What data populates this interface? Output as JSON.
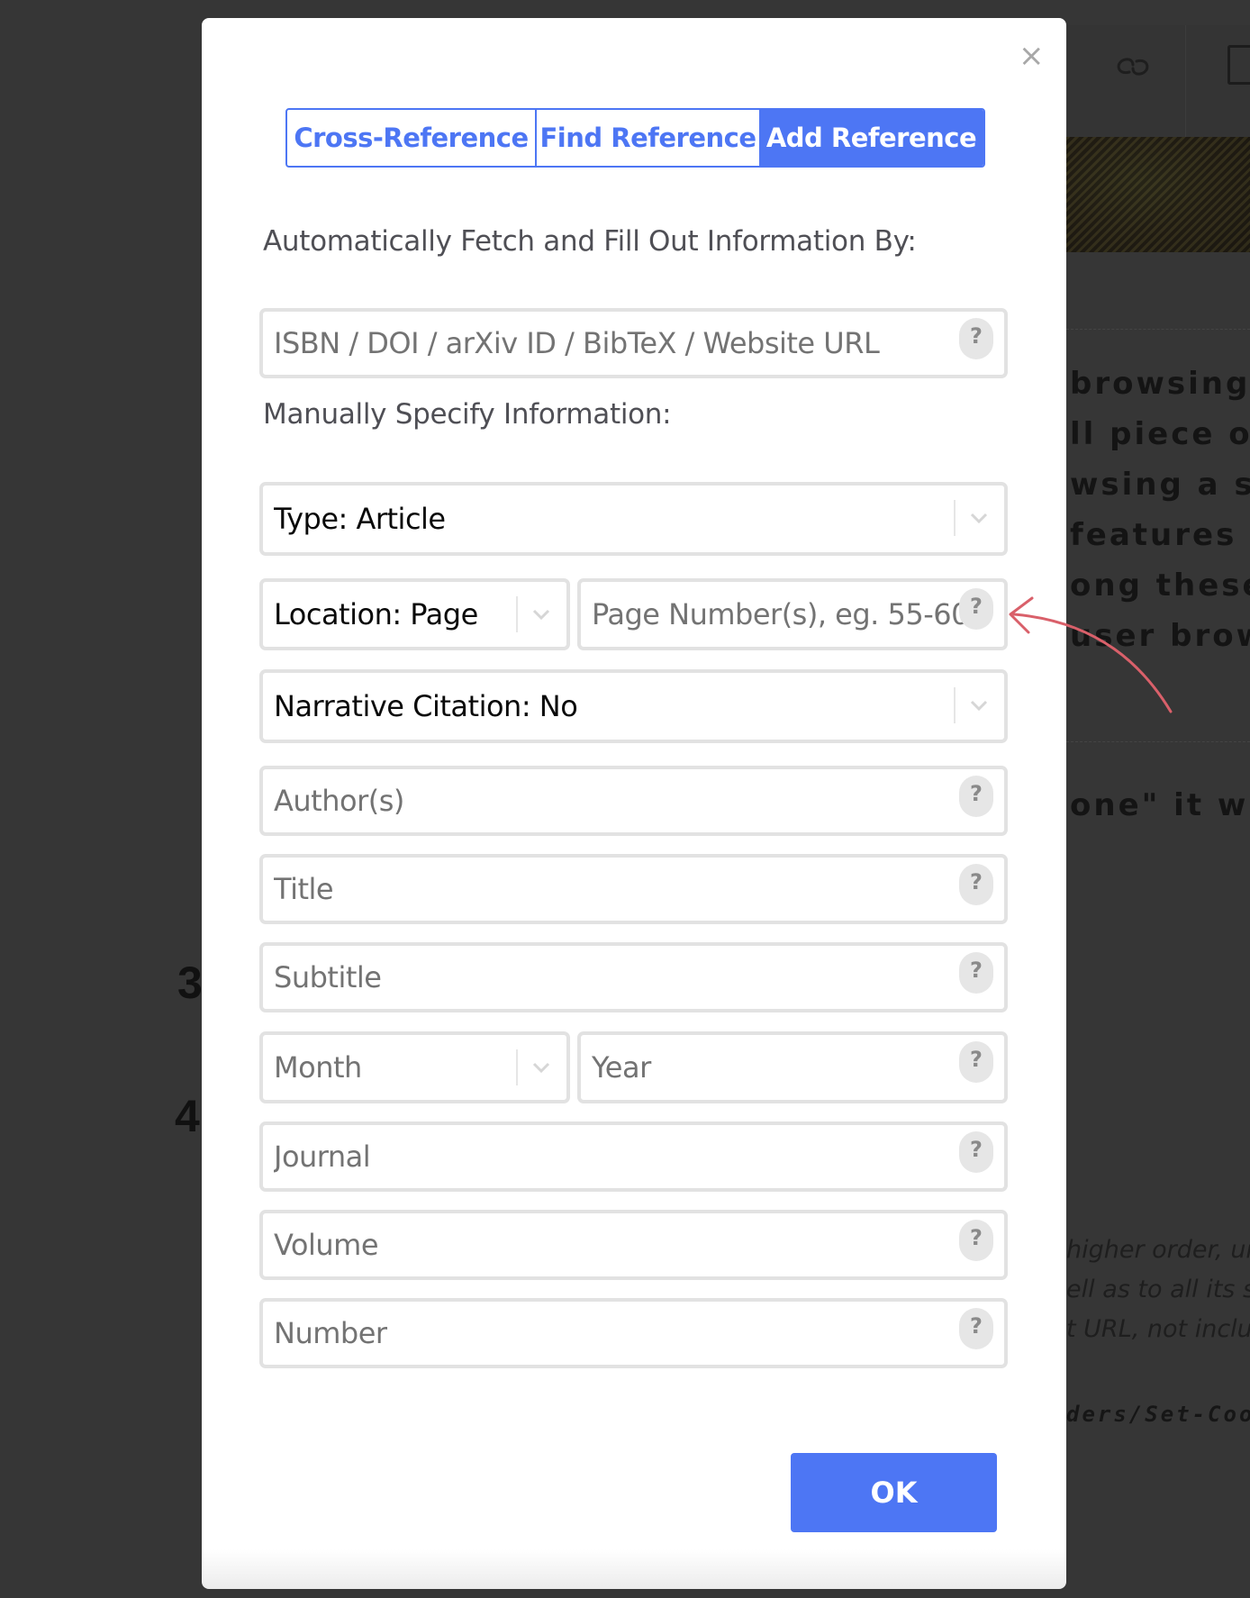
{
  "background": {
    "text_lines": [
      "browsing a",
      "ll piece of d",
      "wsing a site.",
      "features su",
      "ong these, t",
      " user brows"
    ],
    "quote_line": "one\" it will n",
    "italic_lines": [
      "higher order, unle",
      "ell as to all its sub",
      "t URL, not includ"
    ],
    "mono_line": "ders/Set-Cookie",
    "list_numbers": [
      "3",
      "4"
    ]
  },
  "modal": {
    "close_label": "×",
    "tabs": [
      {
        "label": "Cross-Reference",
        "active": false
      },
      {
        "label": "Find Reference",
        "active": false
      },
      {
        "label": "Add Reference",
        "active": true
      }
    ],
    "auto_fetch": {
      "label": "Automatically Fetch and Fill Out Information By:",
      "placeholder": "ISBN / DOI / arXiv ID / BibTeX / Website URL",
      "help": "?"
    },
    "manual": {
      "label": "Manually Specify Information:",
      "type_select": "Type: Article",
      "location_select": "Location: Page",
      "page_placeholder": "Page Number(s), eg. 55-60",
      "narrative_select": "Narrative Citation: No",
      "author_placeholder": "Author(s)",
      "title_placeholder": "Title",
      "subtitle_placeholder": "Subtitle",
      "month_select": "Month",
      "year_placeholder": "Year",
      "journal_placeholder": "Journal",
      "volume_placeholder": "Volume",
      "number_placeholder": "Number",
      "help": "?"
    },
    "ok_label": "OK"
  },
  "colors": {
    "accent": "#4d76f4",
    "annotation_arrow": "#d9606a"
  }
}
